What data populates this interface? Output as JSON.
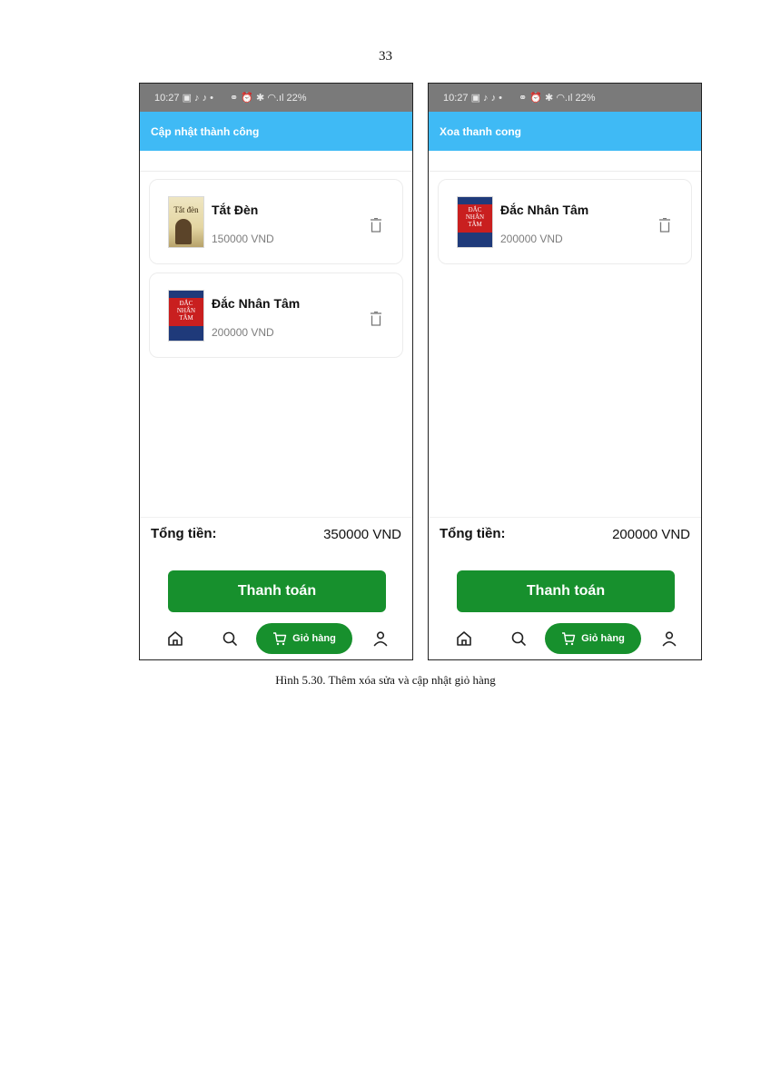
{
  "page_number": "33",
  "caption": "Hình 5.30. Thêm xóa sửa và cập nhật giỏ hàng",
  "status_bar": {
    "time": "10:27",
    "left_icons": "▣ ♪ ♪ •",
    "right_icons": "⚭ ⏰ ✱ ◠.ıl 22%",
    "battery": "22%"
  },
  "phones": [
    {
      "toast": "Cập nhật thành công",
      "items": [
        {
          "name": "Tắt Đèn",
          "price": "150000 VND",
          "cover_title": "Tắt đèn"
        },
        {
          "name": "Đắc Nhân Tâm",
          "price": "200000 VND",
          "cover_title": "ĐẮC\nNHÂN\nTÂM"
        }
      ],
      "total_label": "Tổng tiền:",
      "total_value": "350000 VND",
      "checkout_label": "Thanh toán",
      "nav_cart_label": "Giỏ hàng"
    },
    {
      "toast": "Xoa thanh cong",
      "items": [
        {
          "name": "Đắc Nhân Tâm",
          "price": "200000 VND",
          "cover_title": "ĐẮC\nNHÂN\nTÂM"
        }
      ],
      "total_label": "Tổng tiền:",
      "total_value": "200000 VND",
      "checkout_label": "Thanh toán",
      "nav_cart_label": "Giỏ hàng"
    }
  ],
  "colors": {
    "toast": "#3fbaf5",
    "primary": "#17902d",
    "status_bar": "#7a7a7a"
  },
  "icons": [
    "trash-icon",
    "home-icon",
    "search-icon",
    "cart-icon",
    "user-icon"
  ]
}
